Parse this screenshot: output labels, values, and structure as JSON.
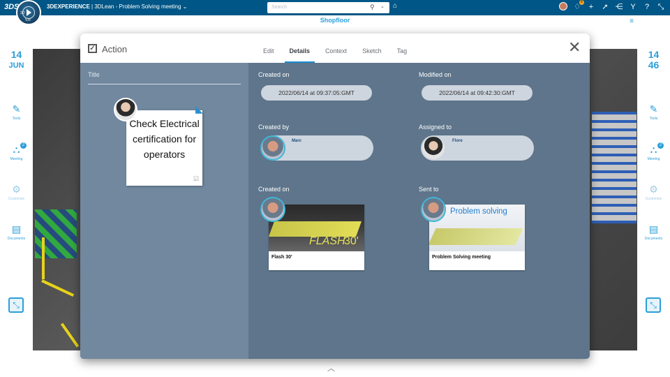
{
  "topbar": {
    "logo": "3DS",
    "app_prefix": "3DEXPERIENCE",
    "separator": "|",
    "app_name": "3DLean - Problem Solving meeting",
    "search_placeholder": "Search",
    "notif_count": "6"
  },
  "compass": {
    "label_3d": "3D",
    "label_vr": "V,R"
  },
  "header": {
    "title": "Shopfloor"
  },
  "left_rail": {
    "date_day": "14",
    "date_month": "JUN",
    "items": [
      {
        "label": "Tools",
        "icon": "tools-icon"
      },
      {
        "label": "Meeting",
        "icon": "meeting-icon",
        "badge": "2"
      },
      {
        "label": "Customize",
        "icon": "gear-icon",
        "disabled": true
      },
      {
        "label": "Documents",
        "icon": "document-icon"
      }
    ]
  },
  "right_rail": {
    "time_hour": "14",
    "time_min": "46",
    "items": [
      {
        "label": "Tools",
        "icon": "tools-icon"
      },
      {
        "label": "Meeting",
        "icon": "meeting-icon",
        "badge": "2"
      },
      {
        "label": "Customize",
        "icon": "gear-icon",
        "disabled": true
      },
      {
        "label": "Documents",
        "icon": "document-icon"
      }
    ]
  },
  "modal": {
    "title": "Action",
    "tabs": [
      "Edit",
      "Details",
      "Context",
      "Sketch",
      "Tag"
    ],
    "active_tab": "Details",
    "left": {
      "title_label": "Title",
      "note_text": "Check Electrical certification for operators"
    },
    "fields": {
      "created_on_label": "Created on",
      "created_on_value": "2022/06/14 at 09:37:05:GMT",
      "modified_on_label": "Modified on",
      "modified_on_value": "2022/06/14 at 09:42:30:GMT",
      "created_by_label": "Created by",
      "created_by_name": "Marc",
      "assigned_to_label": "Assigned to",
      "assigned_to_name": "Flore",
      "created_on2_label": "Created on",
      "created_on2_card": "Flash 30'",
      "created_on2_thumb_text": "FLASH",
      "created_on2_thumb_num": "30'",
      "sent_to_label": "Sent to",
      "sent_to_card": "Problem Solving meeting",
      "sent_to_thumb_text": "Problem solving"
    }
  },
  "colors": {
    "accent": "#2b9fd9",
    "topbar": "#005686",
    "modal_bg": "#5e758b",
    "left_panel": "#71889f"
  }
}
